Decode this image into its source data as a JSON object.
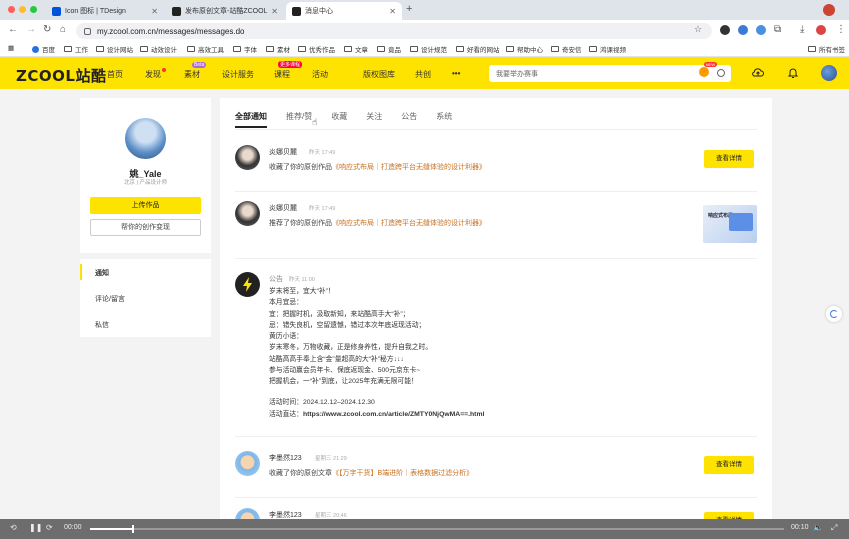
{
  "browser": {
    "tabs": [
      {
        "title": "Icon 图标 | TDesign",
        "active": false
      },
      {
        "title": "发布原创文章-站酷ZCOOL",
        "active": false
      },
      {
        "title": "消息中心",
        "active": true
      }
    ],
    "url": "my.zcool.com.cn/messages/messages.do",
    "bookmarks": [
      "百度",
      "工作",
      "设计网站",
      "动效设计",
      "高效工具",
      "字体",
      "素材",
      "优秀作品",
      "文章",
      "竟品",
      "设计规范",
      "好看的网站",
      "帮助中心",
      "奇安信",
      "鸿课视频"
    ],
    "all_bookmarks_label": "所有书签"
  },
  "site": {
    "logo": "ZCOOL站酷",
    "nav": [
      {
        "label": "首页"
      },
      {
        "label": "发现",
        "dot": true
      },
      {
        "label": "素材",
        "badge": "Beta"
      },
      {
        "label": "设计服务"
      },
      {
        "label": "课程",
        "badge": "更多课程"
      },
      {
        "label": "活动"
      },
      {
        "label": "版权图库"
      },
      {
        "label": "共创"
      },
      {
        "label": "•••"
      }
    ],
    "search_placeholder": "我要举办赛事",
    "search_tag": "NEW"
  },
  "profile": {
    "name": "姚_Yale",
    "subtitle": "北京 | 产品设计师",
    "upload_label": "上传作品",
    "help_label": "帮你的创作变现"
  },
  "side_menu": [
    "通知",
    "评论/留言",
    "私信"
  ],
  "tabs": [
    "全部通知",
    "推荐/赞",
    "收藏",
    "关注",
    "公告",
    "系统"
  ],
  "messages": [
    {
      "user": "炎娜贝麓",
      "time": "昨天 17:49",
      "text": "收藏了你的原创作品",
      "link": "《响应式布局｜打造跨平台无缝体验的设计利器》",
      "action": "查看详情"
    },
    {
      "user": "炎娜贝麓",
      "time": "昨天 17:49",
      "text": "推荐了你的原创作品",
      "link": "《响应式布局｜打造跨平台无缝体验的设计利器》",
      "thumb_title": "响应式布局"
    },
    {
      "user": "公告",
      "time": "昨天 11:00",
      "lines": [
        "岁末将至，宜大“补”！",
        "本月宜忌：",
        "宜：把握时机，汲取新知，来站酷高手大“补”；",
        "忌：错失良机，空留遗憾，错过本次年底返现活动；",
        "黄历小语：",
        "岁末寒冬，万物收藏，正是修身养性，提升自我之时。",
        "站酷高高手奉上含“金”量超高的大“补”秘方↓↓↓",
        "参与活动赢会员年卡、保底返现金、500元京东卡~",
        "把握机会，一“补”到底，让2025年充满无限可能！"
      ],
      "period_label": "活动时间：",
      "period": "2024.12.12–2024.12.30",
      "url_label": "活动直达：",
      "url": "https://www.zcool.com.cn/article/ZMTY0NjQwMA==.html"
    },
    {
      "user": "李墨然123",
      "time": "星期三 21:29",
      "text": "收藏了你的原创文章",
      "link": "《【万字干货】B端进阶｜表格数据过滤分析》",
      "action": "查看详情"
    },
    {
      "user": "李墨然123",
      "time": "星期三 20:46",
      "action": "查看详情"
    }
  ],
  "player": {
    "current": "00:00",
    "duration": "00:10",
    "progress": 0.06
  },
  "colors": {
    "brand_yellow": "#ffe300",
    "link_orange": "#c9701f"
  }
}
